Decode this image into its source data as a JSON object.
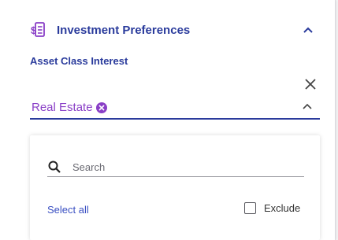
{
  "section": {
    "title": "Investment Preferences",
    "icon": "dollar-document-icon",
    "expanded": true
  },
  "asset_class": {
    "label": "Asset Class Interest",
    "selected_chip": "Real Estate",
    "dropdown_open": true
  },
  "dropdown": {
    "search_placeholder": "Search",
    "select_all_label": "Select all",
    "exclude_label": "Exclude",
    "exclude_checked": false
  },
  "colors": {
    "primary": "#2a3b9c",
    "chip": "#8a3fc7",
    "link": "#3a4fc2"
  }
}
